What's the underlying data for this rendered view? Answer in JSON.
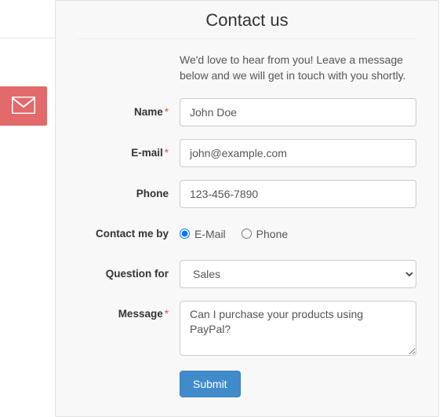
{
  "badge": {
    "icon": "envelope-icon"
  },
  "panel": {
    "title": "Contact us",
    "intro": "We'd love to hear from you! Leave a message below and we will get in touch with you shortly."
  },
  "form": {
    "name": {
      "label": "Name",
      "required": "*",
      "value": "John Doe"
    },
    "email": {
      "label": "E-mail",
      "required": "*",
      "value": "john@example.com"
    },
    "phone": {
      "label": "Phone",
      "value": "123-456-7890"
    },
    "contact_by": {
      "label": "Contact me by",
      "options": {
        "email": "E-Mail",
        "phone": "Phone"
      },
      "selected": "email"
    },
    "question_for": {
      "label": "Question for",
      "selected": "Sales"
    },
    "message": {
      "label": "Message",
      "required": "*",
      "value": "Can I purchase your products using PayPal?"
    },
    "submit": "Submit"
  }
}
